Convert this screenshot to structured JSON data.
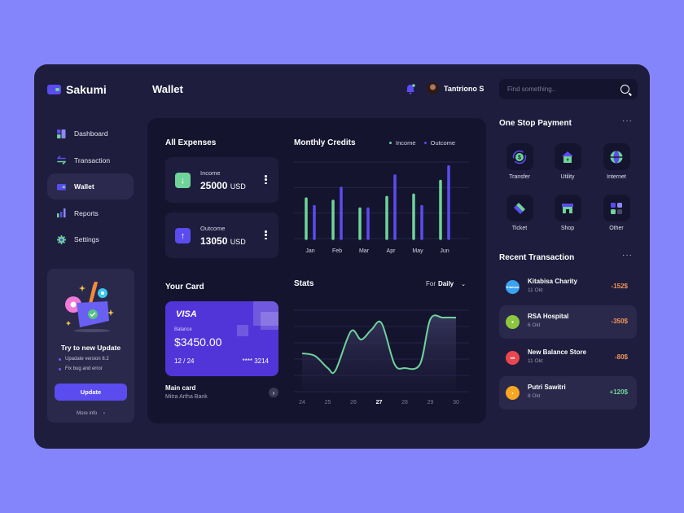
{
  "brand": {
    "name": "Sakumi"
  },
  "header": {
    "title": "Wallet",
    "user_name": "Tantriono S",
    "search_placeholder": "Find something.."
  },
  "sidebar": {
    "items": [
      {
        "label": "Dashboard",
        "icon": "dashboard-icon",
        "active": false
      },
      {
        "label": "Transaction",
        "icon": "transaction-icon",
        "active": false
      },
      {
        "label": "Wallet",
        "icon": "wallet-icon",
        "active": true
      },
      {
        "label": "Reports",
        "icon": "reports-icon",
        "active": false
      },
      {
        "label": "Settings",
        "icon": "settings-icon",
        "active": false
      }
    ],
    "update_card": {
      "title": "Try to new Update",
      "bullets": [
        "Upadate version 8.2",
        "Fix bug and error"
      ],
      "button_label": "Update",
      "more_info": "More info"
    }
  },
  "expenses": {
    "title": "All Expenses",
    "income": {
      "label": "Income",
      "value": "25000",
      "unit": "USD"
    },
    "outcome": {
      "label": "Outcome",
      "value": "13050",
      "unit": "USD"
    }
  },
  "card": {
    "title": "Your Card",
    "brand": "VISA",
    "balance_label": "Balance",
    "balance": "$3450.00",
    "expiry": "12 / 24",
    "number": "**** 3214",
    "name": "Main card",
    "bank": "Mitra Artha Bank"
  },
  "stats": {
    "title": "Stats",
    "filter_prefix": "For",
    "filter_value": "Daily"
  },
  "payment": {
    "title": "One Stop Payment",
    "items": [
      {
        "label": "Transfer",
        "icon": "transfer-icon"
      },
      {
        "label": "Utility",
        "icon": "utility-icon"
      },
      {
        "label": "Internet",
        "icon": "internet-icon"
      },
      {
        "label": "Ticket",
        "icon": "ticket-icon"
      },
      {
        "label": "Shop",
        "icon": "shop-icon"
      },
      {
        "label": "Other",
        "icon": "other-icon"
      }
    ]
  },
  "recent": {
    "title": "Recent Transaction",
    "items": [
      {
        "name": "Kitabisa Charity",
        "date": "11 Okt",
        "amount": "-152$",
        "logo_text": "Kitabisa",
        "logo_color": "#3aa2f0",
        "type": "debit",
        "highlight": false
      },
      {
        "name": "RSA Hospital",
        "date": "6 Okt",
        "amount": "-350$",
        "logo_text": "✚",
        "logo_color": "#8cc63e",
        "type": "debit",
        "highlight": true
      },
      {
        "name": "New Balance Store",
        "date": "11 Okt",
        "amount": "-80$",
        "logo_text": "NB",
        "logo_color": "#e9474f",
        "type": "debit",
        "highlight": false
      },
      {
        "name": "Putri Sawitri",
        "date": "8 Okt",
        "amount": "+120$",
        "logo_text": "●",
        "logo_color": "#f5a623",
        "type": "credit",
        "highlight": true
      }
    ]
  },
  "colors": {
    "background": "#8585fb",
    "app_bg": "#1e1d3d",
    "panel_bg": "#15142e",
    "accent": "#5b4cf0",
    "income": "#6fd39a",
    "outcome": "#5b4cf0",
    "debit": "#f0965a",
    "credit": "#6fd39a"
  },
  "chart_data": [
    {
      "type": "bar",
      "title": "Monthly Credits",
      "categories": [
        "Jan",
        "Feb",
        "Mar",
        "Apr",
        "May",
        "Jun"
      ],
      "series": [
        {
          "name": "Income",
          "values": [
            52,
            49,
            39,
            54,
            57,
            75
          ]
        },
        {
          "name": "Outcome",
          "values": [
            42,
            66,
            39,
            82,
            42,
            94
          ]
        }
      ],
      "ylim": [
        0,
        100
      ],
      "grid": true,
      "legend": "top-right",
      "xlabel": "",
      "ylabel": ""
    },
    {
      "type": "area",
      "title": "Stats",
      "categories": [
        "24",
        "25",
        "26",
        "27",
        "28",
        "29",
        "30"
      ],
      "highlight_category": "27",
      "x": [
        24,
        24.5,
        25,
        25.3,
        25.9,
        26.3,
        26.7,
        27.1,
        27.6,
        28.0,
        28.6,
        29.0,
        29.5,
        30
      ],
      "values": [
        43,
        40,
        25,
        22,
        70,
        60,
        72,
        80,
        30,
        25,
        30,
        85,
        87,
        87
      ],
      "ylim": [
        0,
        100
      ],
      "grid": true,
      "xlabel": "",
      "ylabel": ""
    }
  ]
}
